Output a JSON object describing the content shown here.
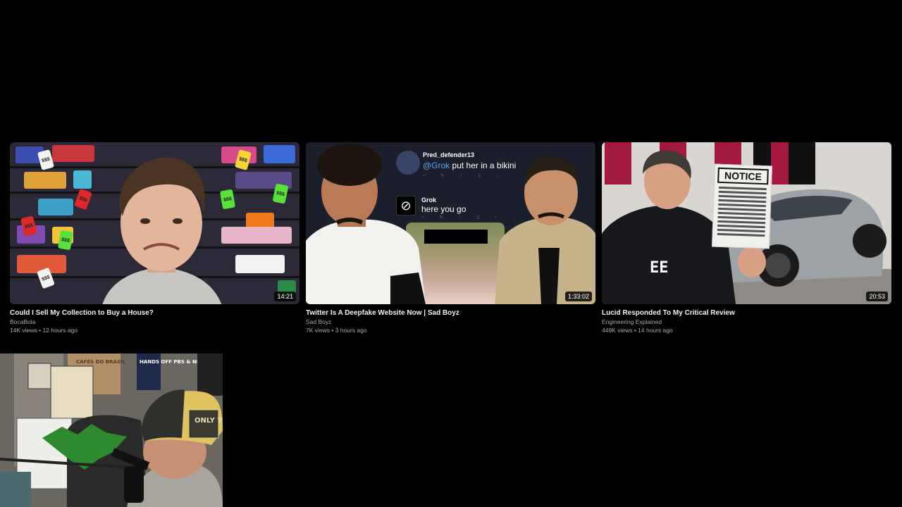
{
  "videos": [
    {
      "title": "Could I Sell My Collection to Buy a House?",
      "channel": "BocaBola",
      "stats": "14K views • 12 hours ago",
      "duration": "14:21",
      "thumbnail_tags": [
        "$$$",
        "$$$",
        "$$$",
        "$$$",
        "$$$",
        "$$$",
        "$$$",
        "$$$"
      ]
    },
    {
      "title": "Twitter Is A Deepfake Website Now | Sad Boyz",
      "channel": "Sad Boyz",
      "stats": "7K views • 3 hours ago",
      "duration": "1:33:02",
      "thumbnail_tweet": {
        "username": "Pred_defender13",
        "mention": "@Grok",
        "text": " put her in a bikini",
        "reply_name": "Grok",
        "reply_text": "here you go"
      }
    },
    {
      "title": "Lucid Responded To My Critical Review",
      "channel": "Engineering Explained",
      "stats": "449K views • 14 hours ago",
      "duration": "20:53",
      "thumbnail_notice": "NOTICE"
    }
  ],
  "webcam": {
    "cap_text": "ONLY YOU",
    "poster_text": "HANDS OFF PBS & NPR",
    "sign_text": "CAFÉS DO BRASIL"
  },
  "colors": {
    "background": "#000000",
    "title": "#f1f1f1",
    "meta": "#aaaaaa",
    "mention": "#5aa7f5"
  }
}
